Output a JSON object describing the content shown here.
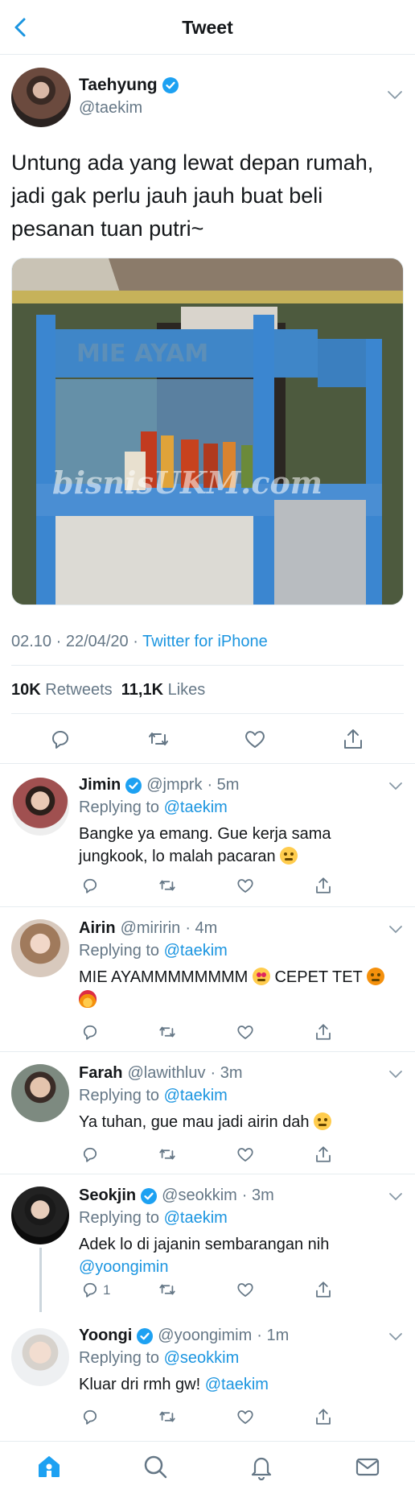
{
  "header": {
    "title": "Tweet"
  },
  "tweet": {
    "name": "Taehyung",
    "handle": "@taekim",
    "text": "Untung ada yang lewat depan rumah, jadi gak perlu jauh jauh buat beli pesanan tuan putri~",
    "photo_sign": "MIE AYAM",
    "photo_watermark": "bisnisUKM.com",
    "time": "02.10 · 22/04/20 · ",
    "source": "Twitter for iPhone",
    "retweets_count": "10K",
    "retweets_label": "Retweets",
    "likes_count": "11,1K",
    "likes_label": "Likes"
  },
  "replies": [
    {
      "name": "Jimin",
      "handle": "@jmprk",
      "time": "· 5m",
      "replying_label": "Replying to",
      "replying_to": "@taekim",
      "text": "Bangke ya emang. Gue kerja sama jungkook, lo malah pacaran",
      "reply_count": ""
    },
    {
      "name": "Airin",
      "handle": "@miririn",
      "time": "· 4m",
      "replying_label": "Replying to",
      "replying_to": "@taekim",
      "text": "MIE AYAMMMMMMMM",
      "text2": "CEPET TET",
      "reply_count": ""
    },
    {
      "name": "Farah",
      "handle": "@lawithluv",
      "time": "· 3m",
      "replying_label": "Replying to",
      "replying_to": "@taekim",
      "text": "Ya tuhan, gue mau jadi airin dah",
      "reply_count": ""
    },
    {
      "name": "Seokjin",
      "handle": "@seokkim",
      "time": "· 3m",
      "replying_label": "Replying to",
      "replying_to": "@taekim",
      "text": "Adek lo di jajanin sembarangan nih",
      "mention": "@yoongimin",
      "reply_count": "1"
    },
    {
      "name": "Yoongi",
      "handle": "@yoongimim",
      "time": "· 1m",
      "replying_label": "Replying to",
      "replying_to": "@seokkim",
      "text": "Kluar dri rmh gw!",
      "mention": "@taekim",
      "reply_count": ""
    }
  ],
  "icons": {
    "accent": "#1b95e0",
    "secondary": "#657786"
  }
}
